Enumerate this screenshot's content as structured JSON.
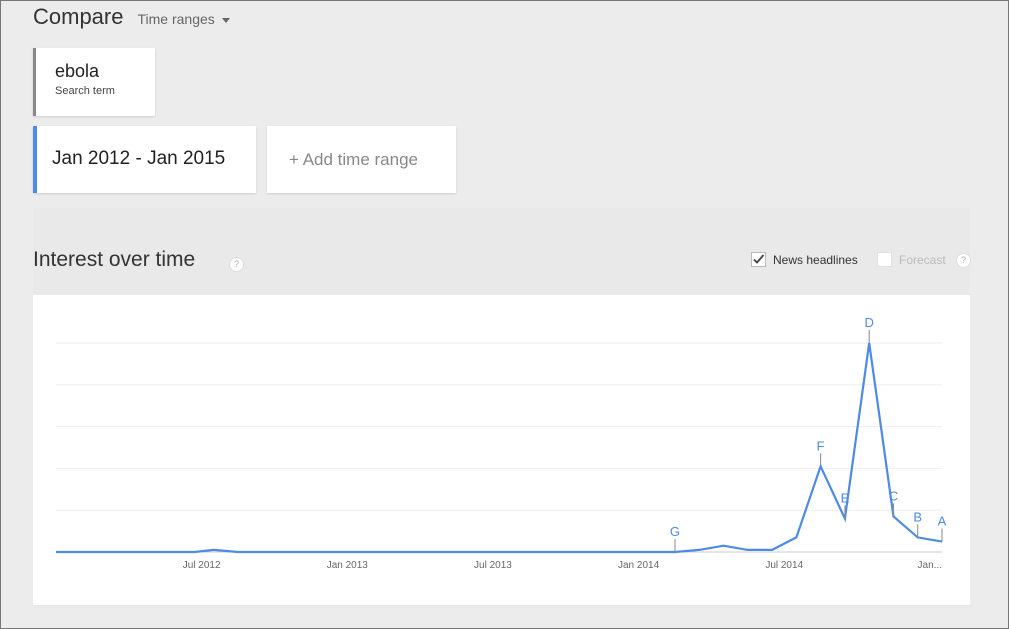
{
  "compare": {
    "title": "Compare",
    "dropdown_label": "Time ranges"
  },
  "search_term": {
    "name": "ebola",
    "subtitle": "Search term",
    "color": "#888888"
  },
  "time_range": {
    "label": "Jan 2012 - Jan 2015",
    "color": "#4d8ae6"
  },
  "add_time_range_label": "+ Add time range",
  "interest_section": {
    "title": "Interest over time",
    "help_icon": "?",
    "news_headlines": {
      "label": "News headlines",
      "checked": true
    },
    "forecast": {
      "label": "Forecast",
      "checked": false,
      "help_icon": "?"
    }
  },
  "chart_data": {
    "type": "line",
    "title": "",
    "xlabel": "",
    "ylabel": "",
    "ylim": [
      0,
      100
    ],
    "grid": true,
    "line_color": "#4d8ae6",
    "x_tick_labels": [
      "Jul 2012",
      "Jan 2013",
      "Jul 2013",
      "Jan 2014",
      "Jul 2014",
      "Jan..."
    ],
    "x_tick_positions_months": [
      6,
      12,
      18,
      24,
      30,
      36
    ],
    "series": [
      {
        "name": "",
        "x_months": [
          0,
          2,
          4,
          5.7,
          6.5,
          7.5,
          8,
          10,
          12,
          14,
          16,
          18,
          20,
          22,
          24,
          25.5,
          26.5,
          27.5,
          28.5,
          29.5,
          30.5,
          31.5,
          32.5,
          33.5,
          34.5,
          35.5,
          36.5
        ],
        "values": [
          0,
          0,
          0,
          0,
          1,
          0,
          0,
          0,
          0,
          0,
          0,
          0,
          0,
          0,
          0,
          0,
          1,
          3,
          1,
          1,
          7,
          41,
          16,
          100,
          17,
          7,
          5
        ]
      }
    ],
    "annotations": [
      {
        "label": "G",
        "x_month": 25.5,
        "value": 0
      },
      {
        "label": "F",
        "x_month": 31.5,
        "value": 41
      },
      {
        "label": "E",
        "x_month": 32.5,
        "value": 16
      },
      {
        "label": "D",
        "x_month": 33.5,
        "value": 100
      },
      {
        "label": "C",
        "x_month": 34.5,
        "value": 17
      },
      {
        "label": "B",
        "x_month": 35.5,
        "value": 7
      },
      {
        "label": "A",
        "x_month": 36.5,
        "value": 5
      }
    ]
  }
}
